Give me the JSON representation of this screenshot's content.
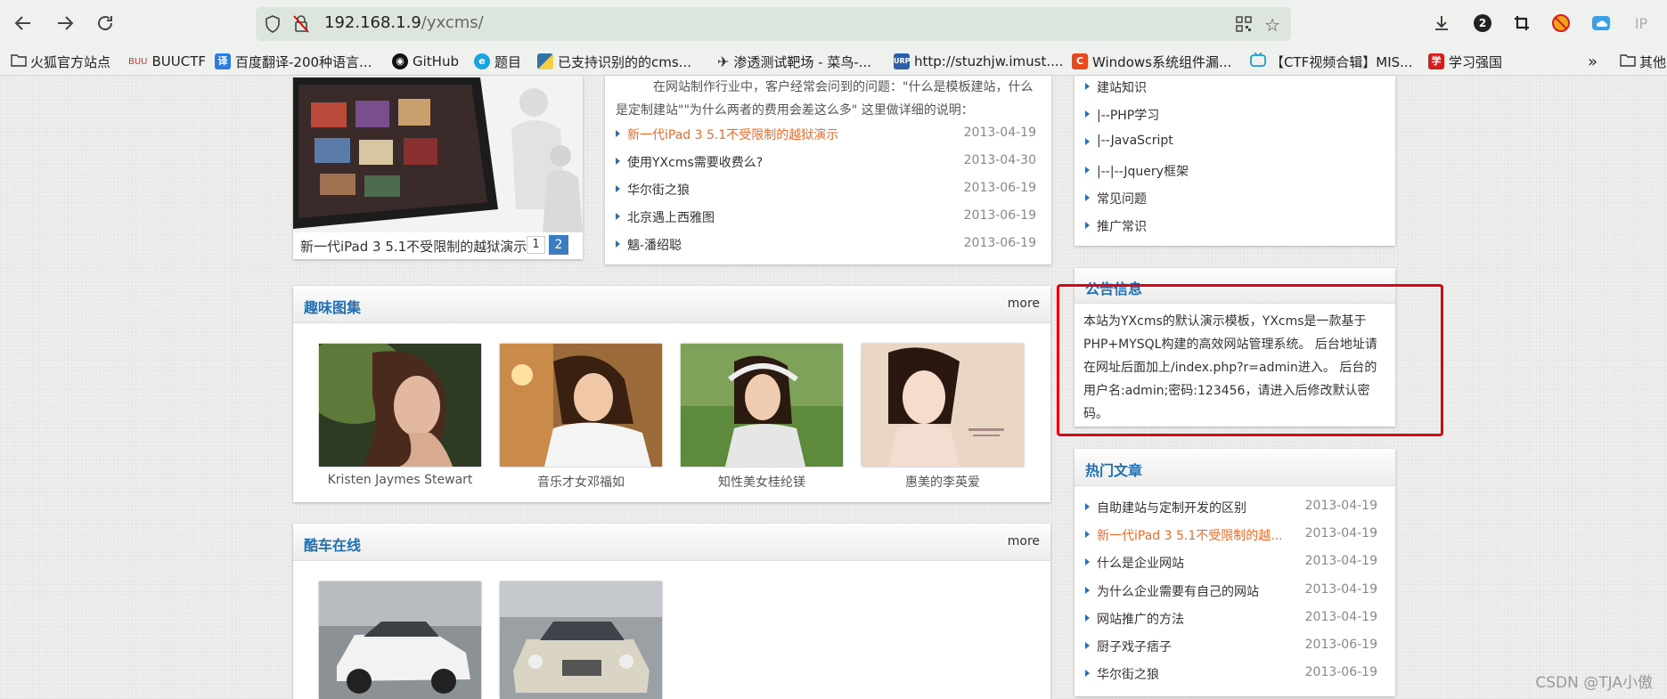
{
  "browser": {
    "url_host": "192.168.1.9",
    "url_path": "/yxcms/",
    "badge_count": "2",
    "ip_label": "IP"
  },
  "bookmarks": [
    {
      "label": "火狐官方站点",
      "icon": "folder-icon"
    },
    {
      "label": "BUUCTF",
      "icon": "buuctf-icon"
    },
    {
      "label": "百度翻译-200种语言...",
      "icon": "translate-icon"
    },
    {
      "label": "GitHub",
      "icon": "github-icon"
    },
    {
      "label": "题目",
      "icon": "globe-icon"
    },
    {
      "label": "已支持识别的的cms...",
      "icon": "python-icon"
    },
    {
      "label": "渗透测试靶场 - 菜鸟-...",
      "icon": "bird-icon"
    },
    {
      "label": "http://stuzhjw.imust....",
      "icon": "urp-icon"
    },
    {
      "label": "Windows系统组件漏...",
      "icon": "c-icon"
    },
    {
      "label": "【CTF视频合辑】MIS...",
      "icon": "bilibili-icon"
    },
    {
      "label": "学习强国",
      "icon": "xuexi-icon"
    },
    {
      "label": "其他",
      "icon": "folder-icon"
    }
  ],
  "slider": {
    "caption": "新一代iPad 3 5.1不受限制的越狱演示",
    "pages": [
      "1",
      "2"
    ]
  },
  "news": {
    "summary": "在网站制作行业中，客户经常会问到的问题：\"什么是模板建站，什么是定制建站\"\"为什么两者的费用会差这么多\" 这里做详细的说明：",
    "items": [
      {
        "title": "新一代iPad 3 5.1不受限制的越狱演示",
        "date": "2013-04-19"
      },
      {
        "title": "使用YXcms需要收费么?",
        "date": "2013-04-30"
      },
      {
        "title": "华尔街之狼",
        "date": "2013-06-19"
      },
      {
        "title": "北京遇上西雅图",
        "date": "2013-06-19"
      },
      {
        "title": "魑-潘绍聪",
        "date": "2013-06-19"
      }
    ]
  },
  "categories": {
    "items": [
      "建站知识",
      "|--PHP学习",
      "|--JavaScript",
      "|--|--Jquery框架",
      "常见问题",
      "推广常识"
    ]
  },
  "gallery": {
    "title": "趣味图集",
    "more": "more",
    "items": [
      {
        "caption": "Kristen Jaymes Stewart"
      },
      {
        "caption": "音乐才女邓福如"
      },
      {
        "caption": "知性美女桂纶镁"
      },
      {
        "caption": "惠美的李英爱"
      }
    ]
  },
  "cars": {
    "title": "酷车在线",
    "more": "more"
  },
  "notice": {
    "title": "公告信息",
    "text": "本站为YXcms的默认演示模板，YXcms是一款基于PHP+MYSQL构建的高效网站管理系统。 后台地址请在网址后面加上/index.php?r=admin进入。 后台的用户名:admin;密码:123456，请进入后修改默认密码。"
  },
  "hot": {
    "title": "热门文章",
    "items": [
      {
        "title": "自助建站与定制开发的区别",
        "date": "2013-04-19"
      },
      {
        "title": "新一代iPad 3 5.1不受限制的越...",
        "date": "2013-04-19"
      },
      {
        "title": "什么是企业网站",
        "date": "2013-04-19"
      },
      {
        "title": "为什么企业需要有自己的网站",
        "date": "2013-04-19"
      },
      {
        "title": "网站推广的方法",
        "date": "2013-04-19"
      },
      {
        "title": "厨子戏子痞子",
        "date": "2013-06-19"
      },
      {
        "title": "华尔街之狼",
        "date": "2013-06-19"
      }
    ]
  },
  "watermark": "CSDN @TJA小傲",
  "colors": {
    "link_blue": "#1f6fb5",
    "highlight_orange": "#f06a2a",
    "annotation_red": "#e60012"
  }
}
